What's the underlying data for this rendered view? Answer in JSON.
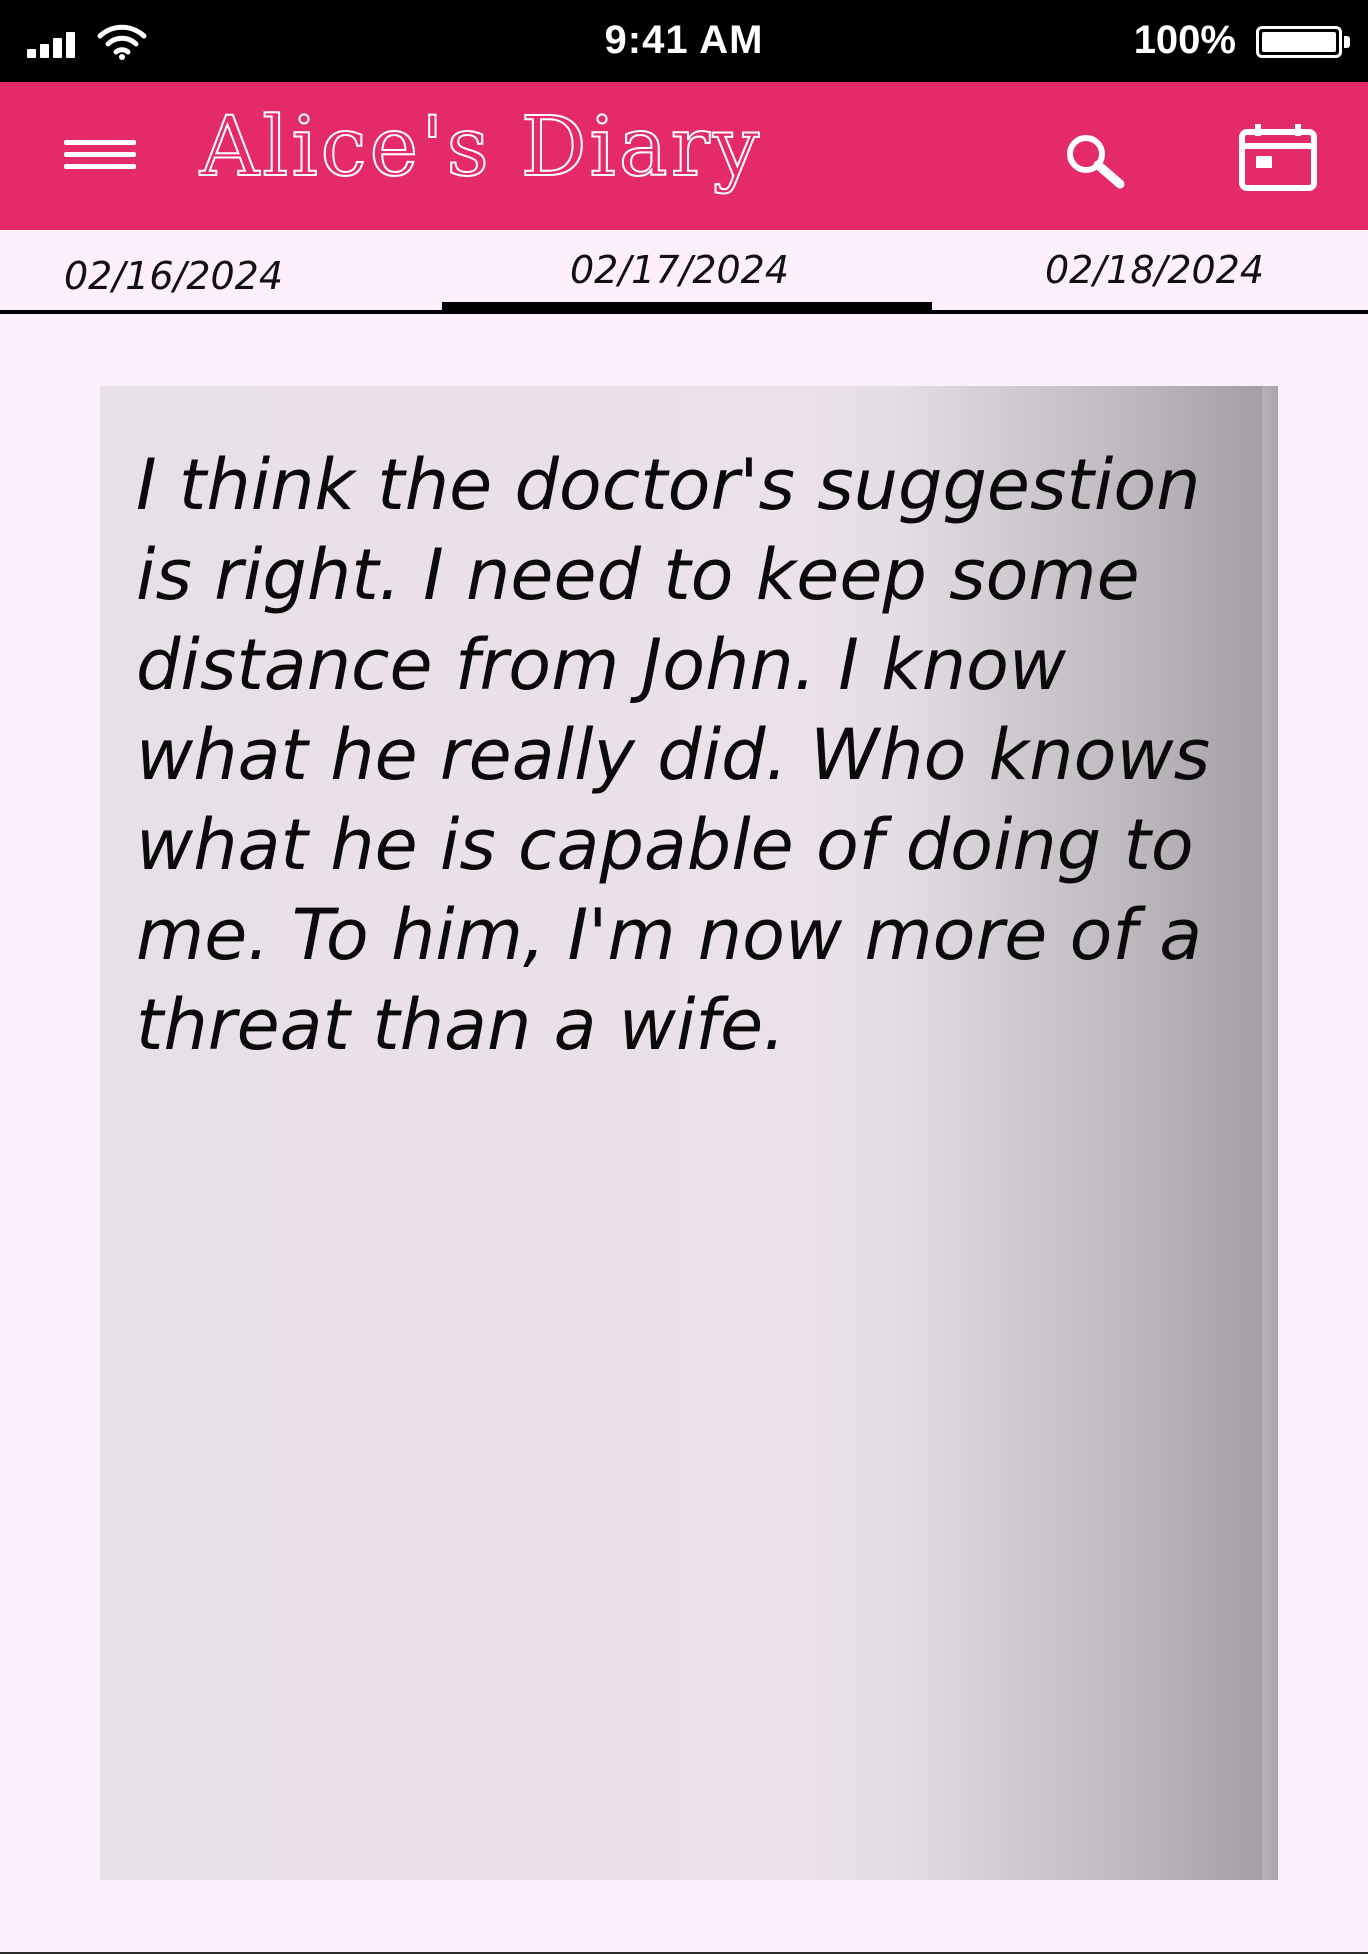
{
  "status_bar": {
    "time": "9:41 AM",
    "battery_text": "100%",
    "battery_level": 1.0,
    "signal_bars": 4
  },
  "header": {
    "title": "Alice's Diary",
    "menu_icon": "hamburger-menu-icon",
    "search_icon": "magnifier-icon",
    "calendar_icon": "calendar-icon",
    "background_color": "#e42a68"
  },
  "date_tabs": {
    "previous": "02/16/2024",
    "current": "02/17/2024",
    "next": "02/18/2024"
  },
  "entry": {
    "text": "I think the doctor's suggestion is right. I need to keep some distance from John. I know what he really did. Who knows what he is capable of doing to me. To him, I'm now more of a threat than a wife."
  },
  "colors": {
    "accent": "#e42a68",
    "page_background": "#fdf0fc"
  }
}
